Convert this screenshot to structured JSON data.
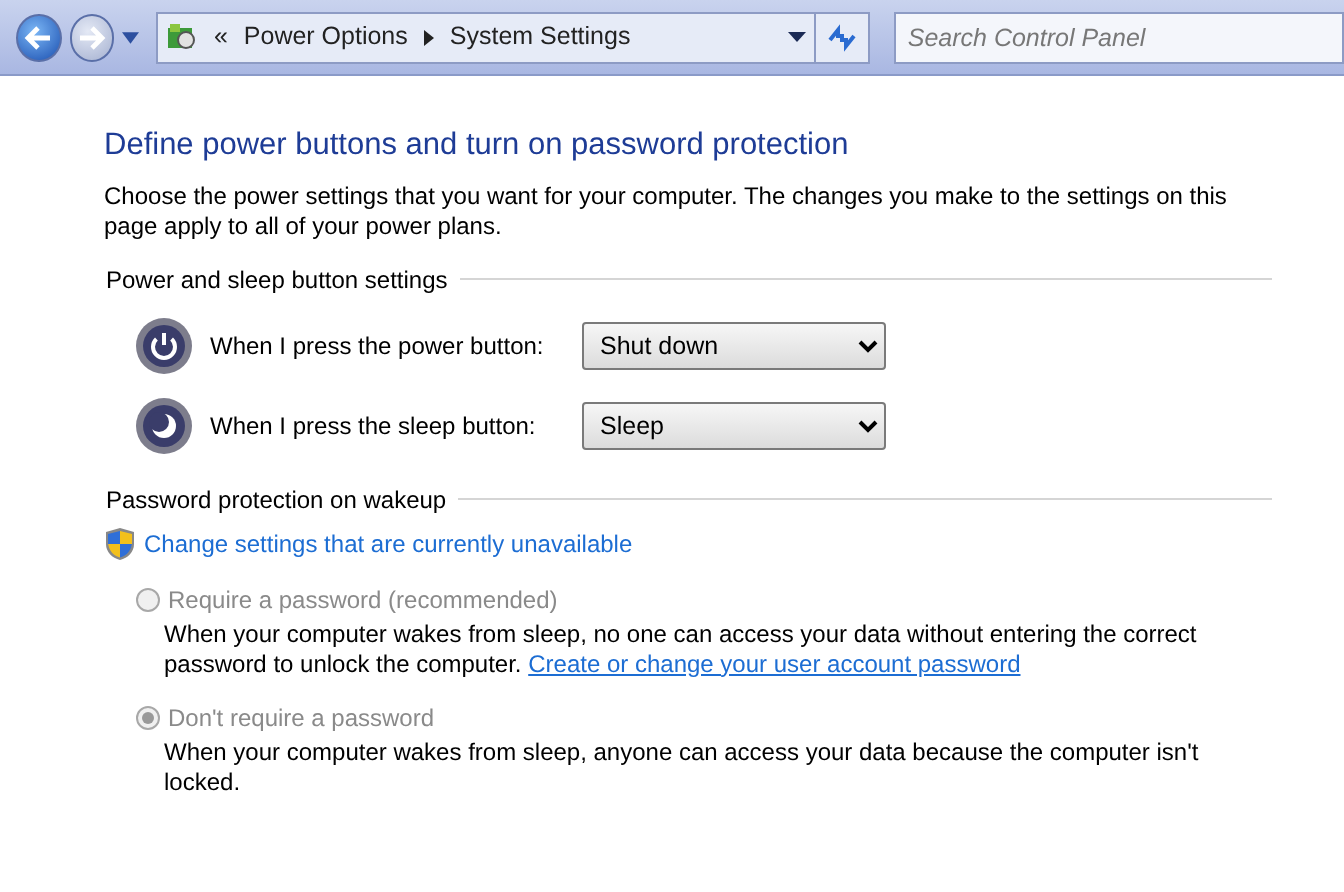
{
  "address_bar": {
    "overflow": "«",
    "breadcrumbs": [
      "Power Options",
      "System Settings"
    ],
    "search": {
      "placeholder": "Search Control Panel"
    }
  },
  "title": "Define power buttons and turn on password protection",
  "intro": "Choose the power settings that you want for your computer. The changes you make to the settings on this page apply to all of your power plans.",
  "button_section": {
    "heading": "Power and sleep button settings",
    "settings": [
      {
        "kind": "power",
        "label": "When I press the power button:",
        "value": "Shut down"
      },
      {
        "kind": "sleep",
        "label": "When I press the sleep button:",
        "value": "Sleep"
      }
    ]
  },
  "password_section": {
    "heading": "Password protection on wakeup",
    "admin_link": "Change settings that are currently unavailable",
    "options": [
      {
        "label": "Require a password (recommended)",
        "selected": false,
        "disabled": true,
        "description": "When your computer wakes from sleep, no one can access your data without entering the correct password to unlock the computer.",
        "link": "Create or change your user account password"
      },
      {
        "label": "Don't require a password",
        "selected": true,
        "disabled": true,
        "description": "When your computer wakes from sleep, anyone can access your data because the computer isn't locked."
      }
    ]
  }
}
